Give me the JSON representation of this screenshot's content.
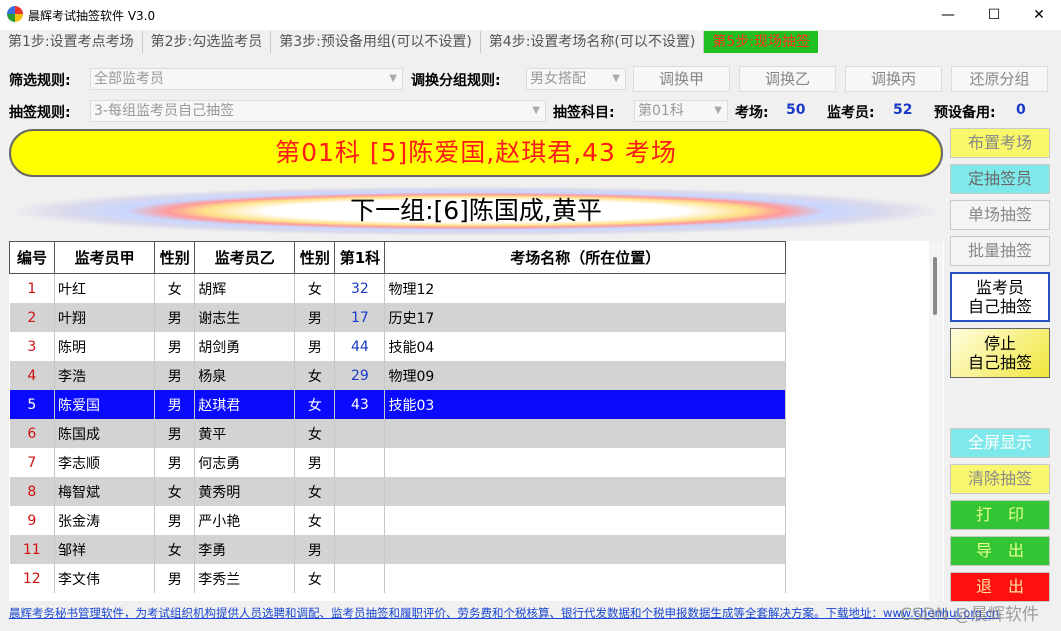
{
  "window": {
    "title": "晨辉考试抽签软件 V3.0",
    "minimize": "—",
    "maximize": "☐",
    "close": "✕"
  },
  "tabs": [
    {
      "label": "第1步:设置考点考场"
    },
    {
      "label": "第2步:勾选监考员"
    },
    {
      "label": "第3步:预设备用组(可以不设置)"
    },
    {
      "label": "第4步:设置考场名称(可以不设置)"
    },
    {
      "label": "第5步:现场抽签",
      "active": true
    }
  ],
  "filter": {
    "filter_label": "筛选规则:",
    "filter_value": "全部监考员",
    "swap_label": "调换分组规则:",
    "swap_value": "男女搭配",
    "swap_a": "调换甲",
    "swap_b": "调换乙",
    "swap_c": "调换丙",
    "restore": "还原分组",
    "draw_rule_label": "抽签规则:",
    "draw_rule_value": "3-每组监考员自己抽签",
    "subject_label": "抽签科目:",
    "subject_value": "第01科",
    "rooms_label": "考场:",
    "rooms_value": "50",
    "invigilators_label": "监考员:",
    "invigilators_value": "52",
    "reserve_label": "预设备用:",
    "reserve_value": "0"
  },
  "banner": {
    "current": "第01科  [5]陈爱国,赵琪君,43 考场",
    "next": "下一组:[6]陈国成,黄平"
  },
  "table": {
    "headers": [
      "编号",
      "监考员甲",
      "性别",
      "监考员乙",
      "性别",
      "第1科",
      "考场名称（所在位置）"
    ],
    "rows": [
      {
        "no": "1",
        "a": "叶红",
        "ga": "女",
        "b": "胡辉",
        "gb": "女",
        "room": "32",
        "place": "物理12"
      },
      {
        "no": "2",
        "a": "叶翔",
        "ga": "男",
        "b": "谢志生",
        "gb": "男",
        "room": "17",
        "place": "历史17"
      },
      {
        "no": "3",
        "a": "陈明",
        "ga": "男",
        "b": "胡剑勇",
        "gb": "男",
        "room": "44",
        "place": "技能04"
      },
      {
        "no": "4",
        "a": "李浩",
        "ga": "男",
        "b": "杨泉",
        "gb": "女",
        "room": "29",
        "place": "物理09"
      },
      {
        "no": "5",
        "a": "陈爱国",
        "ga": "男",
        "b": "赵琪君",
        "gb": "女",
        "room": "43",
        "place": "技能03"
      },
      {
        "no": "6",
        "a": "陈国成",
        "ga": "男",
        "b": "黄平",
        "gb": "女",
        "room": "",
        "place": ""
      },
      {
        "no": "7",
        "a": "李志顺",
        "ga": "男",
        "b": "何志勇",
        "gb": "男",
        "room": "",
        "place": ""
      },
      {
        "no": "8",
        "a": "梅智斌",
        "ga": "女",
        "b": "黄秀明",
        "gb": "女",
        "room": "",
        "place": ""
      },
      {
        "no": "9",
        "a": "张金涛",
        "ga": "男",
        "b": "严小艳",
        "gb": "女",
        "room": "",
        "place": ""
      },
      {
        "no": "11",
        "a": "邹祥",
        "ga": "女",
        "b": "李勇",
        "gb": "男",
        "room": "",
        "place": ""
      },
      {
        "no": "12",
        "a": "李文伟",
        "ga": "男",
        "b": "李秀兰",
        "gb": "女",
        "room": "",
        "place": ""
      }
    ]
  },
  "side": {
    "arrange": "布置考场",
    "fix": "定抽签员",
    "single": "单场抽签",
    "batch": "批量抽签",
    "self_line1": "监考员",
    "self_line2": "自己抽签",
    "stop_line1": "停止",
    "stop_line2": "自己抽签",
    "fullscreen": "全屏显示",
    "clear": "清除抽签",
    "print": "打　印",
    "export": "导　出",
    "exit": "退　出"
  },
  "status": "晨辉考务秘书管理软件，为考试组织机构提供人员选聘和调配、监考员抽签和履职评价、劳务费和个税核算、银行代发数据和个税申报数据生成等全套解决方案。下载地址：www.chenhui.org.cn",
  "watermark": "CSDN @晨辉软件",
  "colors": {
    "active_tab": "#20c020",
    "banner_bg": "#ffff00",
    "banner_text": "#ff1a1a",
    "selected_row": "#0a0aff"
  }
}
